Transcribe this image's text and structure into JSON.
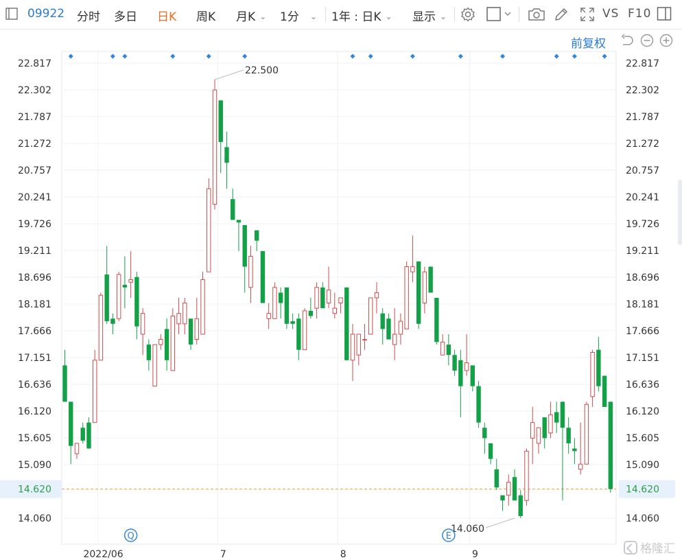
{
  "toolbar": {
    "code": "09922",
    "tabs": [
      {
        "label": "分时",
        "active": false
      },
      {
        "label": "多日",
        "active": false
      },
      {
        "label": "日K",
        "active": true
      },
      {
        "label": "周K",
        "active": false
      },
      {
        "label": "月K",
        "active": false,
        "dropdown": true
      },
      {
        "label": "1分",
        "active": false,
        "dropdown": true
      }
    ],
    "range_select": "1年 : 日K",
    "display_select": "显示",
    "vs_label": "VS",
    "f10_label": "F10",
    "icons": [
      "settings-icon",
      "checkbox-icon",
      "camera-icon",
      "pen-icon",
      "fullscreen-icon",
      "panel-icon"
    ]
  },
  "subbar": {
    "adjust_label": "前复权",
    "icons": [
      "undo-icon",
      "zoom-out-icon",
      "zoom-in-icon"
    ]
  },
  "colors": {
    "up": "#d04a4a",
    "down": "#13a047",
    "accent": "#f26b1d",
    "link": "#2b7bd6",
    "current_line": "#f2973a",
    "current_price_bg": "#e6f1fc"
  },
  "watermark": "格隆汇",
  "chart_data": {
    "type": "candlestick",
    "title": "",
    "y_ticks": [
      "22.817",
      "22.302",
      "21.787",
      "21.272",
      "20.757",
      "20.241",
      "19.726",
      "19.211",
      "18.696",
      "18.181",
      "17.666",
      "17.151",
      "16.636",
      "16.120",
      "15.605",
      "15.090",
      "14.060"
    ],
    "ylim": [
      13.69,
      23.08
    ],
    "x_tick_labels": [
      {
        "index": 6,
        "label": "2022/06"
      },
      {
        "index": 26,
        "label": "7"
      },
      {
        "index": 46,
        "label": "8"
      },
      {
        "index": 68,
        "label": "9"
      }
    ],
    "current_price": "14.620",
    "annotations": [
      {
        "index": 25,
        "label": "22.500",
        "value": 22.5,
        "type": "high"
      },
      {
        "index": 75,
        "label": "14.060",
        "value": 14.06,
        "type": "low"
      }
    ],
    "event_markers": [
      {
        "index": 11,
        "symbol": "Q"
      },
      {
        "index": 64,
        "symbol": "E"
      }
    ],
    "top_markers": [
      1,
      8,
      10,
      18,
      24,
      30,
      48,
      51,
      58,
      66,
      73,
      82,
      85,
      90
    ],
    "candles": [
      {
        "o": 17.0,
        "h": 17.3,
        "l": 16.3,
        "c": 16.3
      },
      {
        "o": 16.3,
        "h": 16.3,
        "l": 15.1,
        "c": 15.45
      },
      {
        "o": 15.3,
        "h": 15.5,
        "l": 15.2,
        "c": 15.5
      },
      {
        "o": 15.8,
        "h": 15.9,
        "l": 15.5,
        "c": 15.55
      },
      {
        "o": 15.9,
        "h": 16.0,
        "l": 15.4,
        "c": 15.4
      },
      {
        "o": 15.9,
        "h": 17.3,
        "l": 15.9,
        "c": 17.1
      },
      {
        "o": 17.1,
        "h": 18.4,
        "l": 17.1,
        "c": 18.35
      },
      {
        "o": 18.75,
        "h": 19.3,
        "l": 17.8,
        "c": 17.85
      },
      {
        "o": 17.9,
        "h": 18.0,
        "l": 17.6,
        "c": 17.8
      },
      {
        "o": 17.9,
        "h": 18.8,
        "l": 17.85,
        "c": 18.75
      },
      {
        "o": 18.55,
        "h": 19.1,
        "l": 18.1,
        "c": 18.5
      },
      {
        "o": 18.6,
        "h": 19.2,
        "l": 18.3,
        "c": 18.65
      },
      {
        "o": 18.7,
        "h": 18.8,
        "l": 17.5,
        "c": 17.75
      },
      {
        "o": 17.6,
        "h": 18.1,
        "l": 17.2,
        "c": 18.0
      },
      {
        "o": 17.4,
        "h": 17.5,
        "l": 16.9,
        "c": 17.1
      },
      {
        "o": 16.6,
        "h": 17.4,
        "l": 16.6,
        "c": 17.4
      },
      {
        "o": 17.4,
        "h": 17.6,
        "l": 17.3,
        "c": 17.5
      },
      {
        "o": 17.7,
        "h": 17.9,
        "l": 16.9,
        "c": 17.1
      },
      {
        "o": 16.9,
        "h": 18.1,
        "l": 16.9,
        "c": 17.95
      },
      {
        "o": 17.8,
        "h": 18.3,
        "l": 17.6,
        "c": 18.0
      },
      {
        "o": 17.8,
        "h": 18.3,
        "l": 17.6,
        "c": 18.2
      },
      {
        "o": 17.9,
        "h": 17.9,
        "l": 17.3,
        "c": 17.4
      },
      {
        "o": 17.5,
        "h": 18.3,
        "l": 17.4,
        "c": 17.9
      },
      {
        "o": 17.6,
        "h": 18.8,
        "l": 17.6,
        "c": 18.65
      },
      {
        "o": 18.8,
        "h": 20.6,
        "l": 18.8,
        "c": 20.4
      },
      {
        "o": 20.1,
        "h": 22.5,
        "l": 20.0,
        "c": 22.3
      },
      {
        "o": 22.1,
        "h": 22.1,
        "l": 20.7,
        "c": 21.3
      },
      {
        "o": 21.2,
        "h": 21.5,
        "l": 20.4,
        "c": 20.9
      },
      {
        "o": 20.2,
        "h": 20.4,
        "l": 19.8,
        "c": 19.8
      },
      {
        "o": 19.8,
        "h": 19.8,
        "l": 19.2,
        "c": 19.75
      },
      {
        "o": 19.7,
        "h": 19.7,
        "l": 18.4,
        "c": 18.9
      },
      {
        "o": 18.5,
        "h": 19.3,
        "l": 18.2,
        "c": 19.1
      },
      {
        "o": 19.6,
        "h": 19.6,
        "l": 19.2,
        "c": 19.4
      },
      {
        "o": 19.2,
        "h": 19.2,
        "l": 18.2,
        "c": 18.2
      },
      {
        "o": 17.9,
        "h": 18.2,
        "l": 17.7,
        "c": 18.0
      },
      {
        "o": 17.9,
        "h": 18.6,
        "l": 17.9,
        "c": 18.5
      },
      {
        "o": 18.4,
        "h": 18.5,
        "l": 17.9,
        "c": 18.2
      },
      {
        "o": 18.5,
        "h": 18.5,
        "l": 17.7,
        "c": 17.8
      },
      {
        "o": 17.85,
        "h": 18.0,
        "l": 17.7,
        "c": 17.8
      },
      {
        "o": 17.9,
        "h": 18.0,
        "l": 17.1,
        "c": 17.3
      },
      {
        "o": 17.3,
        "h": 18.1,
        "l": 17.3,
        "c": 18.05
      },
      {
        "o": 18.05,
        "h": 18.3,
        "l": 17.9,
        "c": 17.95
      },
      {
        "o": 18.1,
        "h": 18.6,
        "l": 17.9,
        "c": 18.5
      },
      {
        "o": 18.5,
        "h": 18.6,
        "l": 18.1,
        "c": 18.1
      },
      {
        "o": 18.2,
        "h": 18.9,
        "l": 18.1,
        "c": 18.45
      },
      {
        "o": 18.0,
        "h": 18.4,
        "l": 17.9,
        "c": 18.1
      },
      {
        "o": 18.2,
        "h": 18.3,
        "l": 18.0,
        "c": 18.3
      },
      {
        "o": 18.5,
        "h": 18.5,
        "l": 17.1,
        "c": 17.1
      },
      {
        "o": 17.1,
        "h": 17.8,
        "l": 16.7,
        "c": 17.6
      },
      {
        "o": 17.2,
        "h": 17.6,
        "l": 17.0,
        "c": 17.6
      },
      {
        "o": 17.5,
        "h": 17.8,
        "l": 17.3,
        "c": 17.5
      },
      {
        "o": 17.6,
        "h": 18.3,
        "l": 17.6,
        "c": 18.3
      },
      {
        "o": 18.3,
        "h": 18.6,
        "l": 18.0,
        "c": 18.4
      },
      {
        "o": 18.0,
        "h": 18.1,
        "l": 17.4,
        "c": 17.7
      },
      {
        "o": 17.9,
        "h": 18.0,
        "l": 17.5,
        "c": 17.5
      },
      {
        "o": 17.4,
        "h": 18.1,
        "l": 17.1,
        "c": 17.6
      },
      {
        "o": 17.6,
        "h": 18.0,
        "l": 17.4,
        "c": 17.85
      },
      {
        "o": 17.7,
        "h": 19.0,
        "l": 17.7,
        "c": 18.9
      },
      {
        "o": 18.8,
        "h": 19.5,
        "l": 18.6,
        "c": 18.9
      },
      {
        "o": 19.0,
        "h": 19.0,
        "l": 17.7,
        "c": 17.8
      },
      {
        "o": 18.2,
        "h": 18.9,
        "l": 18.0,
        "c": 18.8
      },
      {
        "o": 18.9,
        "h": 18.9,
        "l": 18.4,
        "c": 18.4
      },
      {
        "o": 18.3,
        "h": 18.3,
        "l": 17.4,
        "c": 17.45
      },
      {
        "o": 17.2,
        "h": 17.6,
        "l": 17.2,
        "c": 17.45
      },
      {
        "o": 17.4,
        "h": 17.6,
        "l": 17.0,
        "c": 17.2
      },
      {
        "o": 17.2,
        "h": 17.3,
        "l": 16.8,
        "c": 16.9
      },
      {
        "o": 17.1,
        "h": 17.3,
        "l": 16.0,
        "c": 16.6
      },
      {
        "o": 16.9,
        "h": 17.6,
        "l": 16.8,
        "c": 17.05
      },
      {
        "o": 17.0,
        "h": 17.0,
        "l": 16.5,
        "c": 16.6
      },
      {
        "o": 16.6,
        "h": 16.7,
        "l": 15.8,
        "c": 15.9
      },
      {
        "o": 15.8,
        "h": 15.9,
        "l": 15.3,
        "c": 15.6
      },
      {
        "o": 15.5,
        "h": 15.5,
        "l": 15.1,
        "c": 15.2
      },
      {
        "o": 15.0,
        "h": 15.2,
        "l": 14.6,
        "c": 14.65
      },
      {
        "o": 14.5,
        "h": 14.5,
        "l": 14.2,
        "c": 14.4
      },
      {
        "o": 14.5,
        "h": 14.9,
        "l": 14.3,
        "c": 14.75
      },
      {
        "o": 14.85,
        "h": 15.0,
        "l": 14.6,
        "c": 14.4
      },
      {
        "o": 14.5,
        "h": 14.6,
        "l": 14.06,
        "c": 14.1
      },
      {
        "o": 14.4,
        "h": 15.4,
        "l": 14.3,
        "c": 15.35
      },
      {
        "o": 15.6,
        "h": 16.2,
        "l": 15.1,
        "c": 15.9
      },
      {
        "o": 15.5,
        "h": 15.8,
        "l": 15.3,
        "c": 15.8
      },
      {
        "o": 16.0,
        "h": 16.0,
        "l": 15.4,
        "c": 15.6
      },
      {
        "o": 15.7,
        "h": 16.3,
        "l": 15.6,
        "c": 16.05
      },
      {
        "o": 16.1,
        "h": 16.3,
        "l": 15.7,
        "c": 15.9
      },
      {
        "o": 16.3,
        "h": 16.3,
        "l": 14.4,
        "c": 15.8
      },
      {
        "o": 15.8,
        "h": 16.0,
        "l": 15.3,
        "c": 15.5
      },
      {
        "o": 15.4,
        "h": 15.6,
        "l": 15.1,
        "c": 15.35
      },
      {
        "o": 15.0,
        "h": 15.9,
        "l": 14.9,
        "c": 15.1
      },
      {
        "o": 15.1,
        "h": 16.3,
        "l": 15.1,
        "c": 16.25
      },
      {
        "o": 16.4,
        "h": 17.3,
        "l": 16.2,
        "c": 17.25
      },
      {
        "o": 17.3,
        "h": 17.55,
        "l": 16.5,
        "c": 16.6
      },
      {
        "o": 16.8,
        "h": 16.8,
        "l": 16.2,
        "c": 16.2
      },
      {
        "o": 16.3,
        "h": 16.3,
        "l": 14.55,
        "c": 14.62
      }
    ]
  }
}
